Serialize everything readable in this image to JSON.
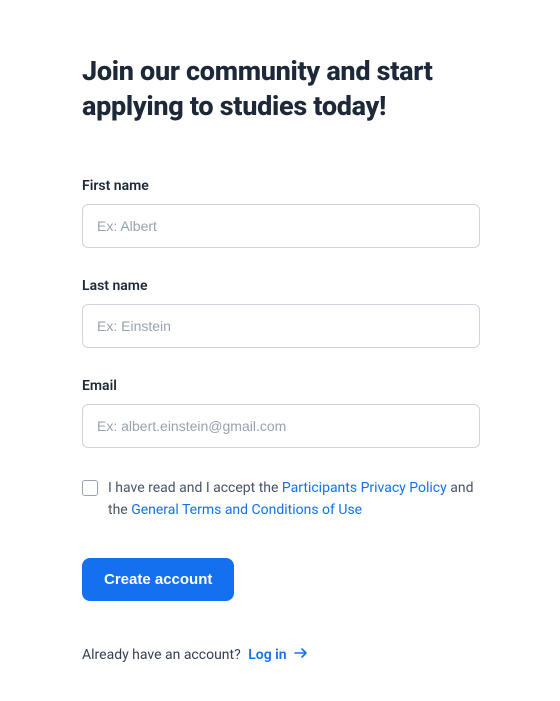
{
  "title": "Join our community and start applying to studies today!",
  "fields": {
    "firstName": {
      "label": "First name",
      "placeholder": "Ex: Albert"
    },
    "lastName": {
      "label": "Last name",
      "placeholder": "Ex: Einstein"
    },
    "email": {
      "label": "Email",
      "placeholder": "Ex: albert.einstein@gmail.com"
    }
  },
  "consent": {
    "prefix": "I have read and I accept the ",
    "link1": "Participants Privacy Policy",
    "middle": " and the ",
    "link2": "General Terms and Conditions of Use"
  },
  "submit": "Create account",
  "footer": {
    "text": "Already have an account?",
    "link": "Log in"
  },
  "colors": {
    "accent": "#1570ef",
    "heading": "#1d2939",
    "bodyText": "#475467",
    "border": "#d0d5dd",
    "placeholder": "#98a2b3"
  }
}
